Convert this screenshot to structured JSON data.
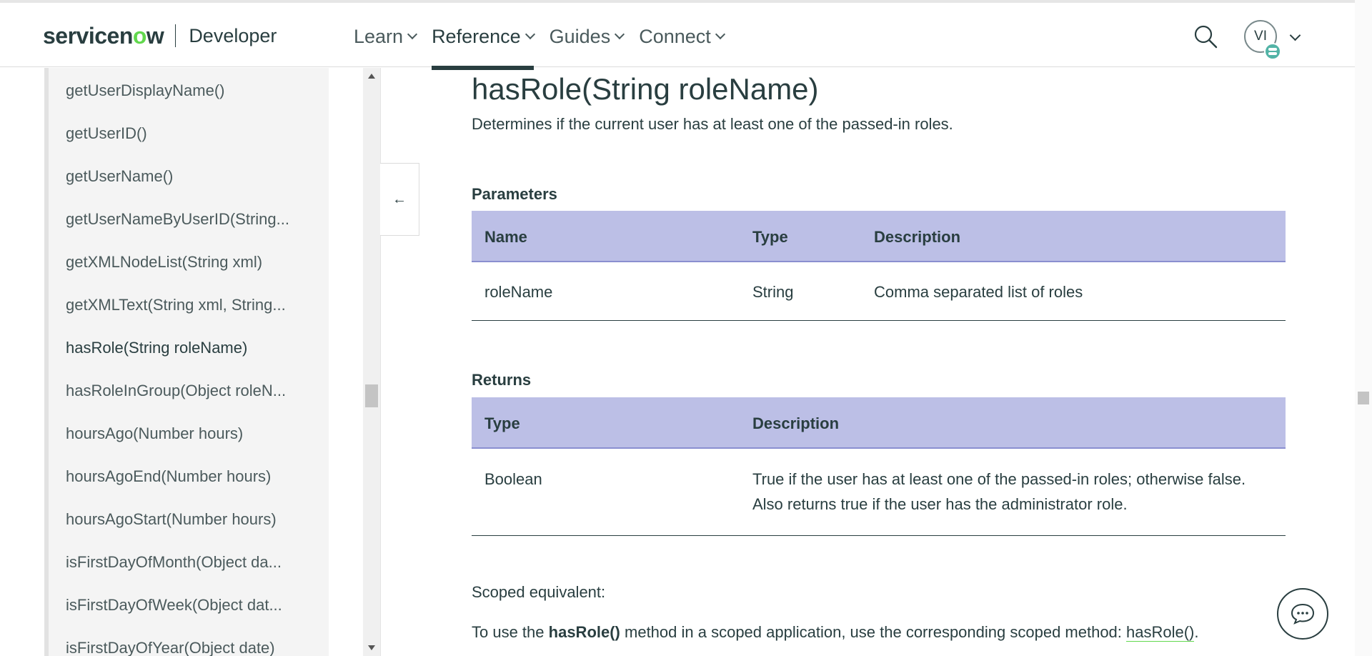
{
  "header": {
    "logo_text_pre": "servicen",
    "logo_text_o": "o",
    "logo_text_post": "w",
    "logo_product": "Developer",
    "nav": [
      {
        "label": "Learn"
      },
      {
        "label": "Reference"
      },
      {
        "label": "Guides"
      },
      {
        "label": "Connect"
      }
    ],
    "active_nav": "Reference",
    "avatar_initials": "VI"
  },
  "sidebar": {
    "items": [
      {
        "label": "getUserDisplayName()"
      },
      {
        "label": "getUserID()"
      },
      {
        "label": "getUserName()"
      },
      {
        "label": "getUserNameByUserID(String..."
      },
      {
        "label": "getXMLNodeList(String xml)"
      },
      {
        "label": "getXMLText(String xml, String..."
      },
      {
        "label": "hasRole(String roleName)"
      },
      {
        "label": "hasRoleInGroup(Object roleN..."
      },
      {
        "label": "hoursAgo(Number hours)"
      },
      {
        "label": "hoursAgoEnd(Number hours)"
      },
      {
        "label": "hoursAgoStart(Number hours)"
      },
      {
        "label": "isFirstDayOfMonth(Object da..."
      },
      {
        "label": "isFirstDayOfWeek(Object dat..."
      },
      {
        "label": "isFirstDayOfYear(Object date)"
      }
    ],
    "active_index": 6,
    "collapse_arrow": "←"
  },
  "main": {
    "title": "hasRole(String roleName)",
    "description": "Determines if the current user has at least one of the passed-in roles.",
    "parameters": {
      "heading": "Parameters",
      "columns": [
        "Name",
        "Type",
        "Description"
      ],
      "rows": [
        [
          "roleName",
          "String",
          "Comma separated list of roles"
        ]
      ]
    },
    "returns": {
      "heading": "Returns",
      "columns": [
        "Type",
        "Description"
      ],
      "rows": [
        [
          "Boolean",
          "True if the user has at least one of the passed-in roles; otherwise false.",
          "Also returns true if the user has the administrator role."
        ]
      ]
    },
    "scoped": {
      "label": "Scoped equivalent:",
      "text_before": "To use the ",
      "method_bold": "hasRole()",
      "text_after": " method in a scoped application, use the corresponding scoped method: ",
      "link": "hasRole()",
      "text_end": "."
    }
  },
  "colors": {
    "accent": "#5a62c4",
    "table_header": "#bcbfe6",
    "brand_green": "#62d84e",
    "text": "#293e40"
  }
}
